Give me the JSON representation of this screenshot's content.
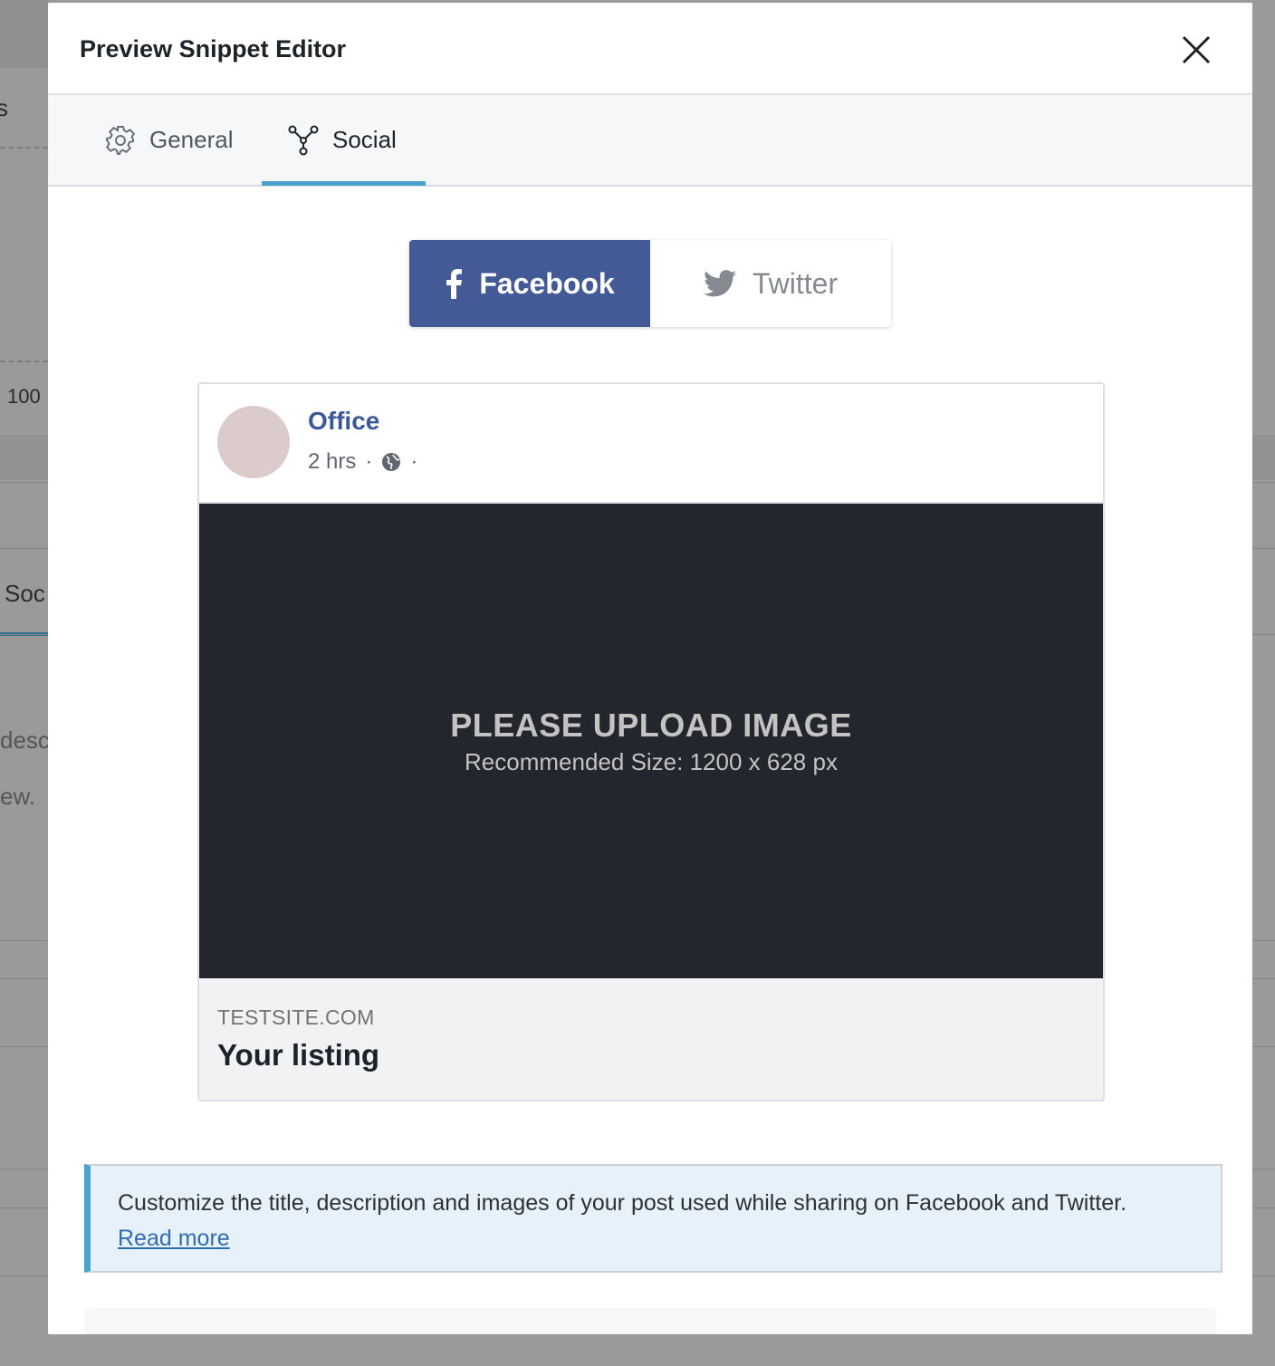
{
  "background": {
    "fragments": [
      "s",
      "100",
      "Soc",
      "desc",
      "ew."
    ]
  },
  "modal": {
    "title": "Preview Snippet Editor",
    "tabs": [
      {
        "label": "General",
        "icon": "gear-icon"
      },
      {
        "label": "Social",
        "icon": "share-icon"
      }
    ],
    "active_tab": "Social"
  },
  "social_toggle": {
    "options": [
      {
        "label": "Facebook",
        "icon": "facebook-icon"
      },
      {
        "label": "Twitter",
        "icon": "twitter-icon"
      }
    ],
    "selected": "Facebook",
    "colors": {
      "facebook_bg": "#445a96",
      "twitter_text": "#848a90"
    }
  },
  "facebook_preview": {
    "page_name": "Office",
    "time": "2 hrs",
    "separator": "·",
    "image_placeholder": {
      "title": "PLEASE UPLOAD IMAGE",
      "subtitle": "Recommended Size: 1200 x 628 px"
    },
    "domain": "TESTSITE.COM",
    "title": "Your listing"
  },
  "notice": {
    "text": "Customize the title, description and images of your post used while sharing on Facebook and Twitter.",
    "link": "Read more"
  }
}
